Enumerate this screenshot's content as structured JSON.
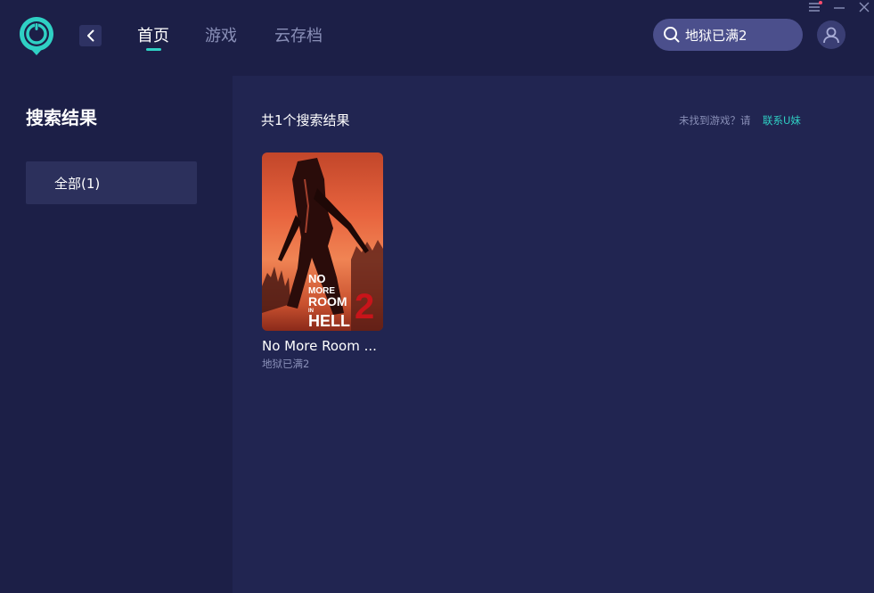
{
  "header": {
    "nav_tabs": [
      {
        "label": "首页",
        "active": true
      },
      {
        "label": "游戏",
        "active": false
      },
      {
        "label": "云存档",
        "active": false
      }
    ],
    "search_value": "地狱已满2",
    "icons": {
      "logo": "app-logo-icon",
      "back": "chevron-left-icon",
      "search": "search-icon",
      "avatar": "user-avatar-icon",
      "menu": "menu-icon",
      "minimize": "minimize-icon",
      "close": "close-icon"
    }
  },
  "sidebar": {
    "title": "搜索结果",
    "filters": [
      {
        "label": "全部(1)",
        "selected": true
      }
    ]
  },
  "main": {
    "result_count": "共1个搜索结果",
    "not_found_text": "未找到游戏？请",
    "contact_link": "联系U妹",
    "games": [
      {
        "title": "No More Room ...",
        "subtitle": "地狱已满2",
        "cover_text": [
          "NO",
          "MORE",
          "ROOM",
          "IN",
          "HELL",
          "2"
        ]
      }
    ]
  },
  "colors": {
    "accent": "#2fd0c4",
    "background": "#1e2045",
    "header_bg": "#1c1f47",
    "main_bg": "#212551",
    "muted_text": "#8a90b8",
    "notification_dot": "#ff4d6d"
  }
}
